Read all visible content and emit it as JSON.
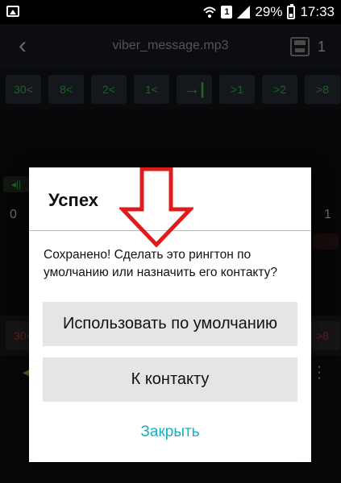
{
  "statusbar": {
    "icon": "image-icon",
    "sim": "1",
    "battery": "29%",
    "time": "17:33"
  },
  "appbar": {
    "title": "viber_message.mp3",
    "save_count": "1"
  },
  "seek_top": [
    "30<",
    "8<",
    "2<",
    "1<",
    "→|",
    ">1",
    ">2",
    ">8"
  ],
  "seek_bottom": [
    "30<",
    "",
    "",
    "",
    "",
    "",
    "",
    ">8"
  ],
  "waveform": {
    "left_marker": "◂||",
    "start_label": "0",
    "end_label": "1"
  },
  "dialog": {
    "title": "Успех",
    "message": "Сохранено! Сделать это рингтон по умолчанию или назначить его контакту?",
    "default_button": "Использовать по умолчанию",
    "contact_button": "К контакту",
    "close_button": "Закрыть"
  },
  "colors": {
    "accent": "#15b0c2",
    "arrow": "#e01b1b",
    "seek_green": "#2fb43b",
    "seek_red": "#c03030"
  }
}
